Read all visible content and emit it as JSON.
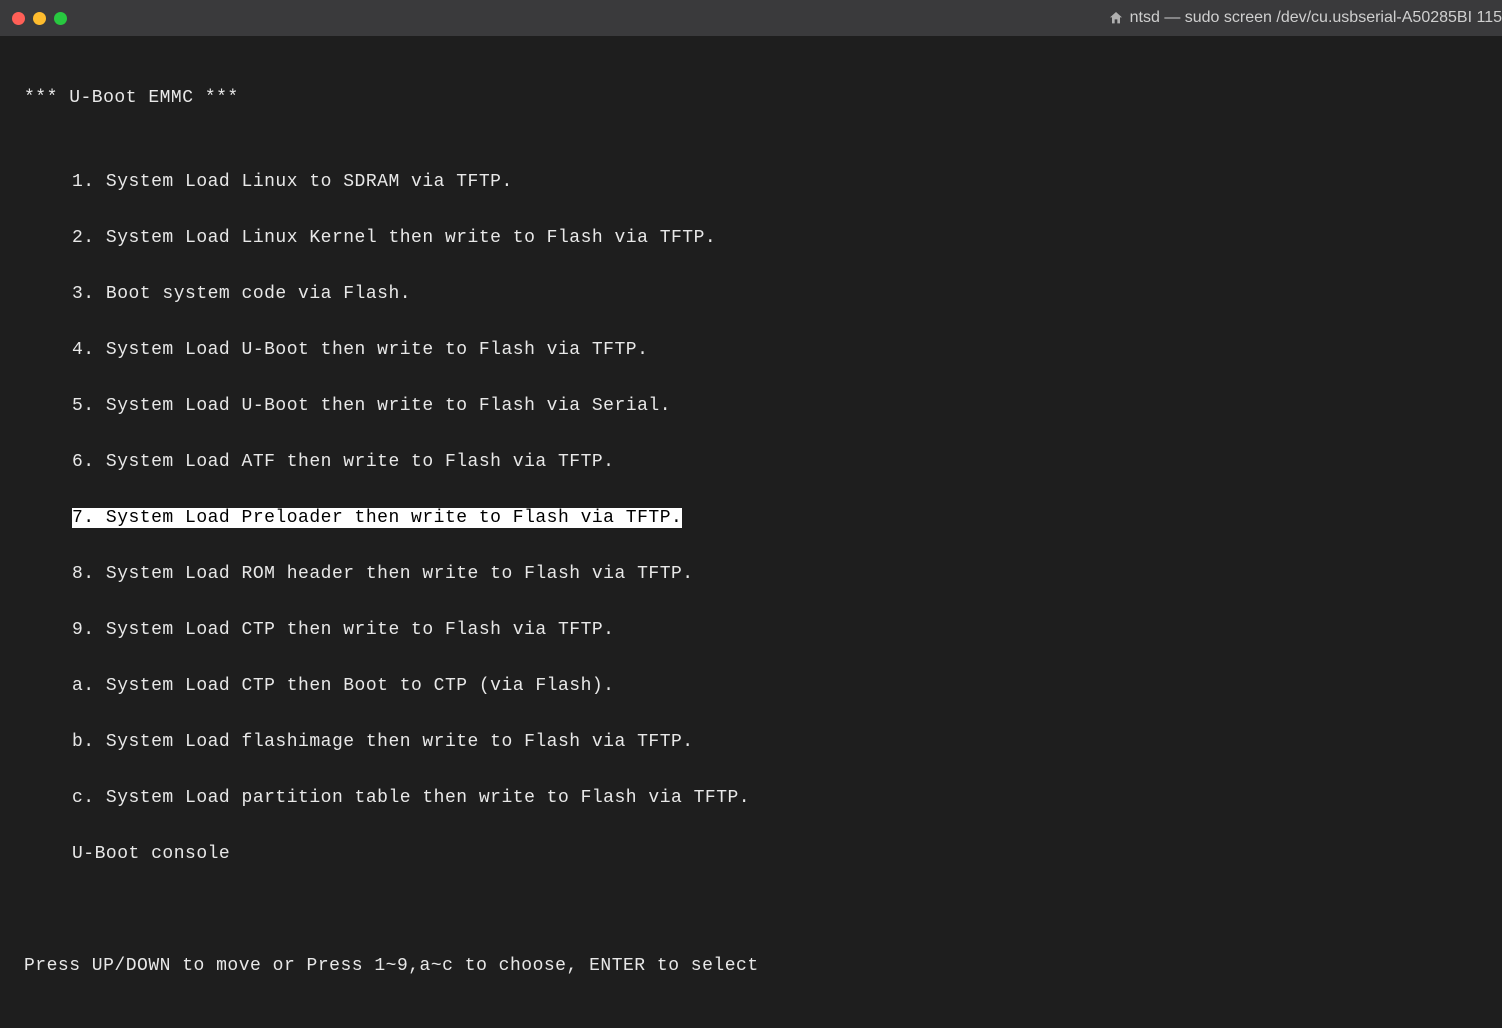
{
  "window": {
    "title": "ntsd — sudo screen /dev/cu.usbserial-A50285BI 115"
  },
  "terminal": {
    "header": "*** U-Boot EMMC ***",
    "menu_items": [
      {
        "key": "1",
        "text": "1. System Load Linux to SDRAM via TFTP.",
        "selected": false
      },
      {
        "key": "2",
        "text": "2. System Load Linux Kernel then write to Flash via TFTP.",
        "selected": false
      },
      {
        "key": "3",
        "text": "3. Boot system code via Flash.",
        "selected": false
      },
      {
        "key": "4",
        "text": "4. System Load U-Boot then write to Flash via TFTP.",
        "selected": false
      },
      {
        "key": "5",
        "text": "5. System Load U-Boot then write to Flash via Serial.",
        "selected": false
      },
      {
        "key": "6",
        "text": "6. System Load ATF then write to Flash via TFTP.",
        "selected": false
      },
      {
        "key": "7",
        "text": "7. System Load Preloader then write to Flash via TFTP.",
        "selected": true
      },
      {
        "key": "8",
        "text": "8. System Load ROM header then write to Flash via TFTP.",
        "selected": false
      },
      {
        "key": "9",
        "text": "9. System Load CTP then write to Flash via TFTP.",
        "selected": false
      },
      {
        "key": "a",
        "text": "a. System Load CTP then Boot to CTP (via Flash).",
        "selected": false
      },
      {
        "key": "b",
        "text": "b. System Load flashimage then write to Flash via TFTP.",
        "selected": false
      },
      {
        "key": "c",
        "text": "c. System Load partition table then write to Flash via TFTP.",
        "selected": false
      }
    ],
    "console_line": "U-Boot console",
    "footer": "Press UP/DOWN to move or Press 1~9,a~c to choose, ENTER to select"
  }
}
